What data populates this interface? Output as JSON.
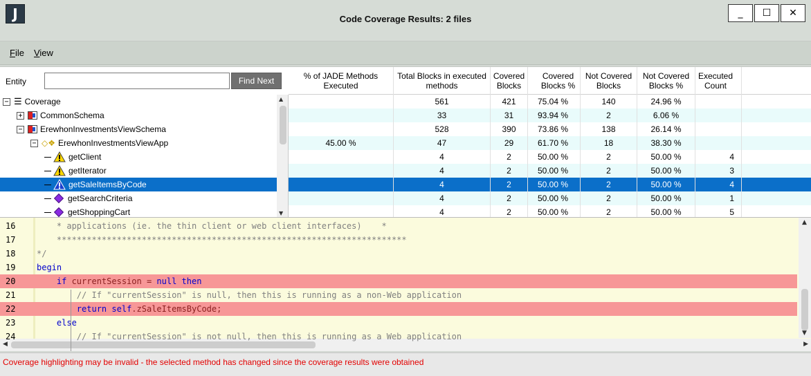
{
  "window": {
    "icon_letter": "J",
    "title": "Code Coverage Results: 2 files",
    "minimize": "_",
    "maximize": "☐",
    "close": "✕"
  },
  "menu": [
    {
      "label": "File",
      "mnemonic": "F",
      "rest": "ile"
    },
    {
      "label": "View",
      "mnemonic": "V",
      "rest": "iew"
    }
  ],
  "search": {
    "label": "Entity",
    "value": "",
    "button": "Find Next"
  },
  "tree": [
    {
      "label": "Coverage",
      "icon": "list-icon",
      "level": 0,
      "expanded": true
    },
    {
      "label": "CommonSchema",
      "icon": "schema-icon",
      "level": 1,
      "expanded": false
    },
    {
      "label": "ErewhonInvestmentsViewSchema",
      "icon": "schema-icon",
      "level": 1,
      "expanded": true
    },
    {
      "label": "ErewhonInvestmentsViewApp",
      "icon": "application-icon",
      "level": 2,
      "expanded": true
    },
    {
      "label": "getClient",
      "icon": "warning-icon",
      "level": 3
    },
    {
      "label": "getIterator",
      "icon": "warning-icon",
      "level": 3
    },
    {
      "label": "getSaleItemsByCode",
      "icon": "warning-icon",
      "level": 3,
      "selected": true
    },
    {
      "label": "getSearchCriteria",
      "icon": "method-icon",
      "level": 3
    },
    {
      "label": "getShoppingCart",
      "icon": "method-icon",
      "level": 3
    }
  ],
  "grid": {
    "headers": [
      "% of JADE Methods Executed",
      "Total Blocks in executed methods",
      "Covered Blocks",
      "Covered Blocks %",
      "Not Covered Blocks",
      "Not Covered Blocks %",
      "Executed Count"
    ],
    "rows": [
      [
        "",
        "561",
        "421",
        "75.04 %",
        "140",
        "24.96 %",
        ""
      ],
      [
        "",
        "33",
        "31",
        "93.94 %",
        "2",
        "6.06 %",
        ""
      ],
      [
        "",
        "528",
        "390",
        "73.86 %",
        "138",
        "26.14 %",
        ""
      ],
      [
        "45.00 %",
        "47",
        "29",
        "61.70 %",
        "18",
        "38.30 %",
        ""
      ],
      [
        "",
        "4",
        "2",
        "50.00 %",
        "2",
        "50.00 %",
        "4"
      ],
      [
        "",
        "4",
        "2",
        "50.00 %",
        "2",
        "50.00 %",
        "3"
      ],
      [
        "",
        "4",
        "2",
        "50.00 %",
        "2",
        "50.00 %",
        "4"
      ],
      [
        "",
        "4",
        "2",
        "50.00 %",
        "2",
        "50.00 %",
        "1"
      ],
      [
        "",
        "4",
        "2",
        "50.00 %",
        "2",
        "50.00 %",
        "5"
      ]
    ],
    "selected_row": 6
  },
  "code": {
    "lines": [
      {
        "n": "16",
        "text": "    * applications (ie. the thin client or web client interfaces)    *",
        "kind": "comment",
        "hl": false
      },
      {
        "n": "17",
        "text": "    **********************************************************************",
        "kind": "comment",
        "hl": false
      },
      {
        "n": "18",
        "text": "*/",
        "kind": "comment",
        "hl": false
      },
      {
        "n": "19",
        "text": "begin",
        "kind": "keyword",
        "hl": false
      },
      {
        "n": "20",
        "text": "    if currentSession = null then",
        "kind": "keyword",
        "hl": true
      },
      {
        "n": "21",
        "text": "        // If \"currentSession\" is null, then this is running as a non-Web application",
        "kind": "comment",
        "hl": false
      },
      {
        "n": "22",
        "text": "        return self.zSaleItemsByCode;",
        "kind": "keyword",
        "hl": true
      },
      {
        "n": "23",
        "text": "    else",
        "kind": "keyword",
        "hl": false
      },
      {
        "n": "24",
        "text": "        // If \"currentSession\" is not null, then this is running as a Web application",
        "kind": "comment",
        "hl": false
      }
    ]
  },
  "status": "Coverage highlighting may be invalid - the selected method has changed since the coverage results were obtained",
  "colors": {
    "selection": "#0b6fc9",
    "highlight": "#f79797",
    "code_bg": "#fbfbdd",
    "status_text": "#e30000"
  }
}
